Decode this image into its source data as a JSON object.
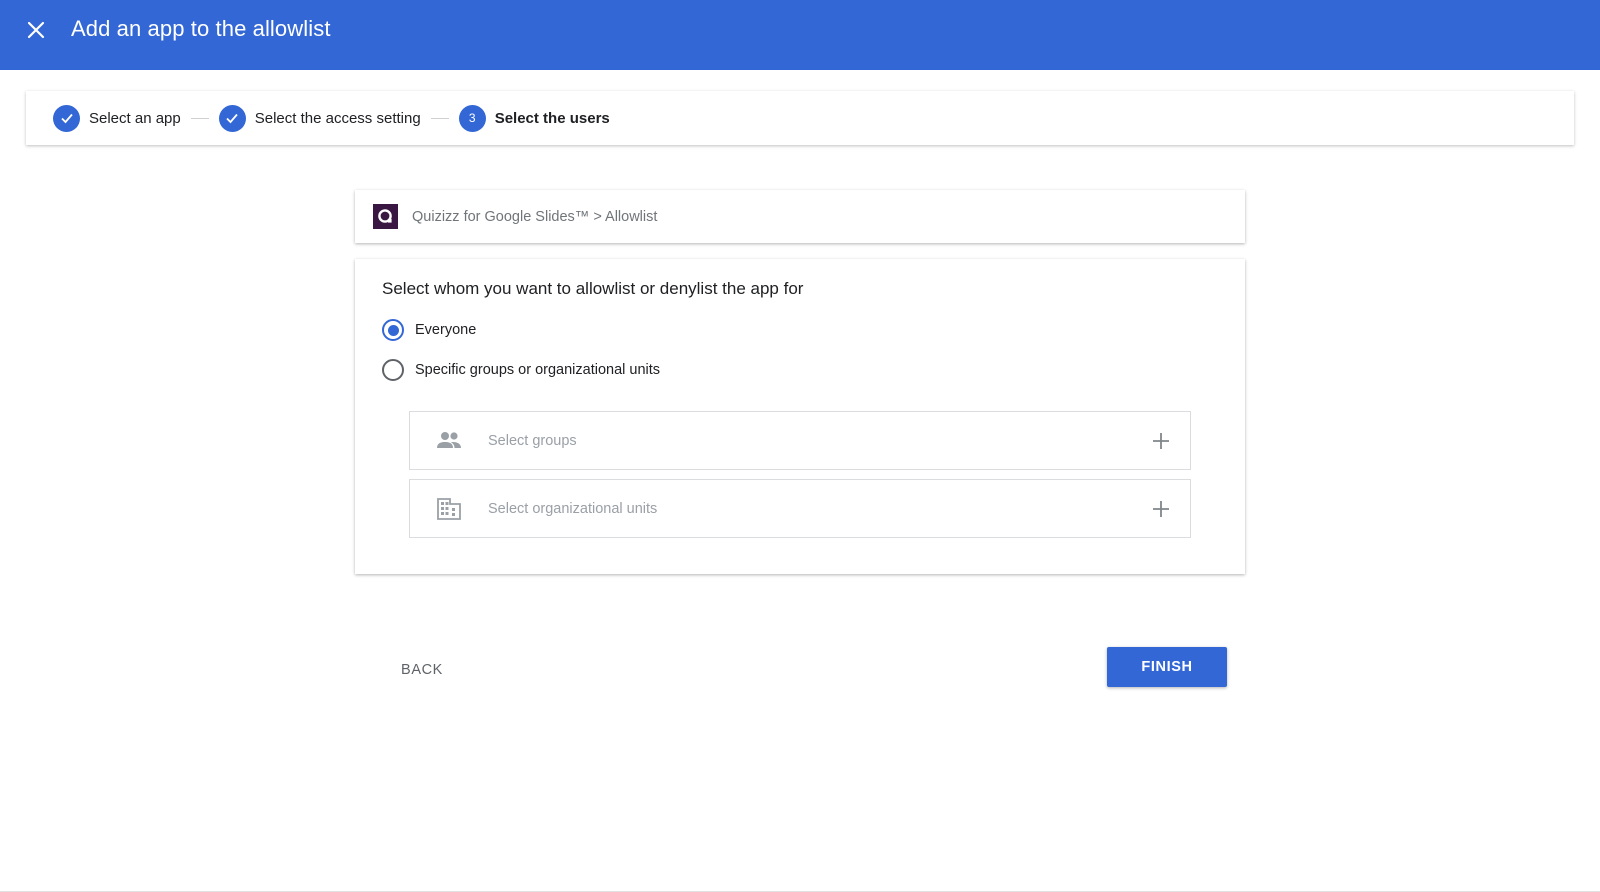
{
  "colors": {
    "brand": "#3367d6",
    "app_logo_bg": "#3a1743"
  },
  "header": {
    "title": "Add an app to the allowlist",
    "close_icon": "close-icon"
  },
  "stepper": {
    "steps": [
      {
        "label": "Select an app",
        "state": "done",
        "marker": ""
      },
      {
        "label": "Select the access setting",
        "state": "done",
        "marker": ""
      },
      {
        "label": "Select the users",
        "state": "active",
        "marker": "3"
      }
    ]
  },
  "app": {
    "path": "Quizizz for Google Slides™ > Allowlist",
    "logo_icon": "quizizz-logo-icon"
  },
  "form": {
    "heading": "Select whom you want to allowlist or denylist the app for",
    "options": [
      {
        "label": "Everyone",
        "checked": true
      },
      {
        "label": "Specific groups or organizational units",
        "checked": false
      }
    ],
    "selectors": [
      {
        "label": "Select groups",
        "icon": "people-icon"
      },
      {
        "label": "Select organizational units",
        "icon": "building-icon"
      }
    ]
  },
  "actions": {
    "back": "BACK",
    "finish": "FINISH"
  }
}
